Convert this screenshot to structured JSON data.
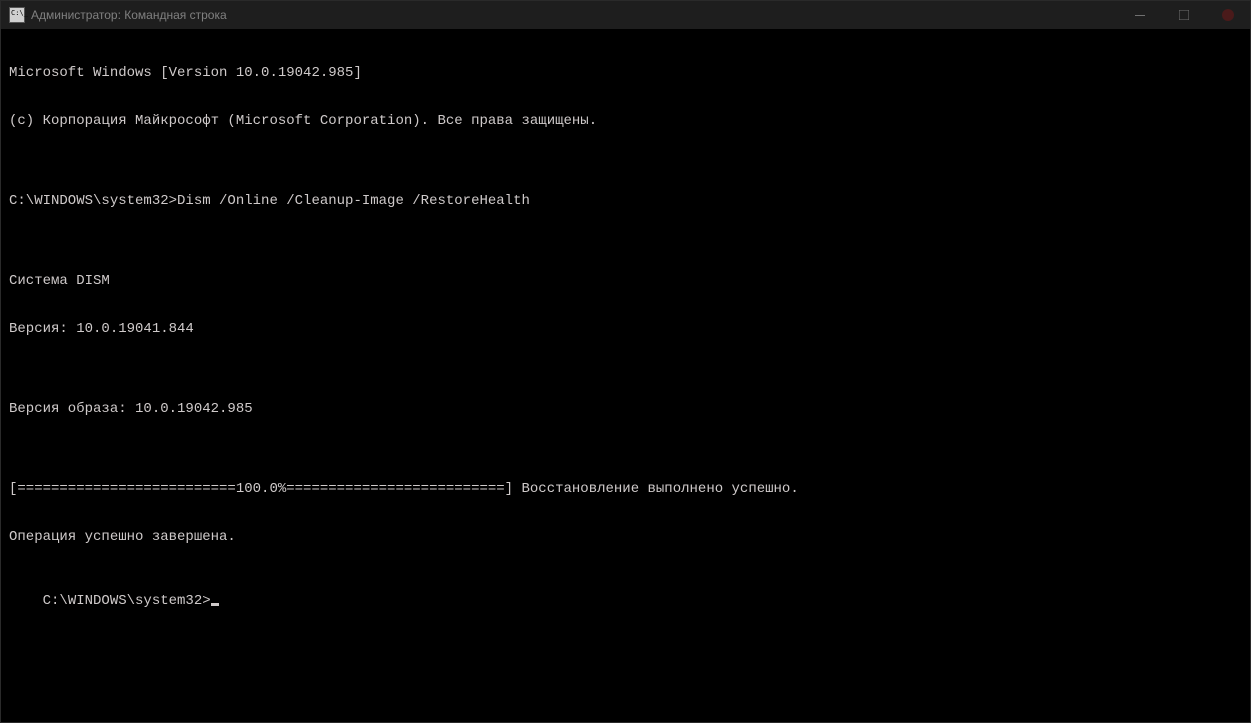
{
  "titlebar": {
    "title": "Администратор: Командная строка"
  },
  "terminal": {
    "lines": [
      "Microsoft Windows [Version 10.0.19042.985]",
      "(c) Корпорация Майкрософт (Microsoft Corporation). Все права защищены.",
      "",
      "C:\\WINDOWS\\system32>Dism /Online /Cleanup-Image /RestoreHealth",
      "",
      "Cистема DISM",
      "Версия: 10.0.19041.844",
      "",
      "Версия образа: 10.0.19042.985",
      "",
      "[==========================100.0%==========================] Восстановление выполнено успешно.",
      "Операция успешно завершена.",
      ""
    ],
    "prompt": "C:\\WINDOWS\\system32>"
  }
}
